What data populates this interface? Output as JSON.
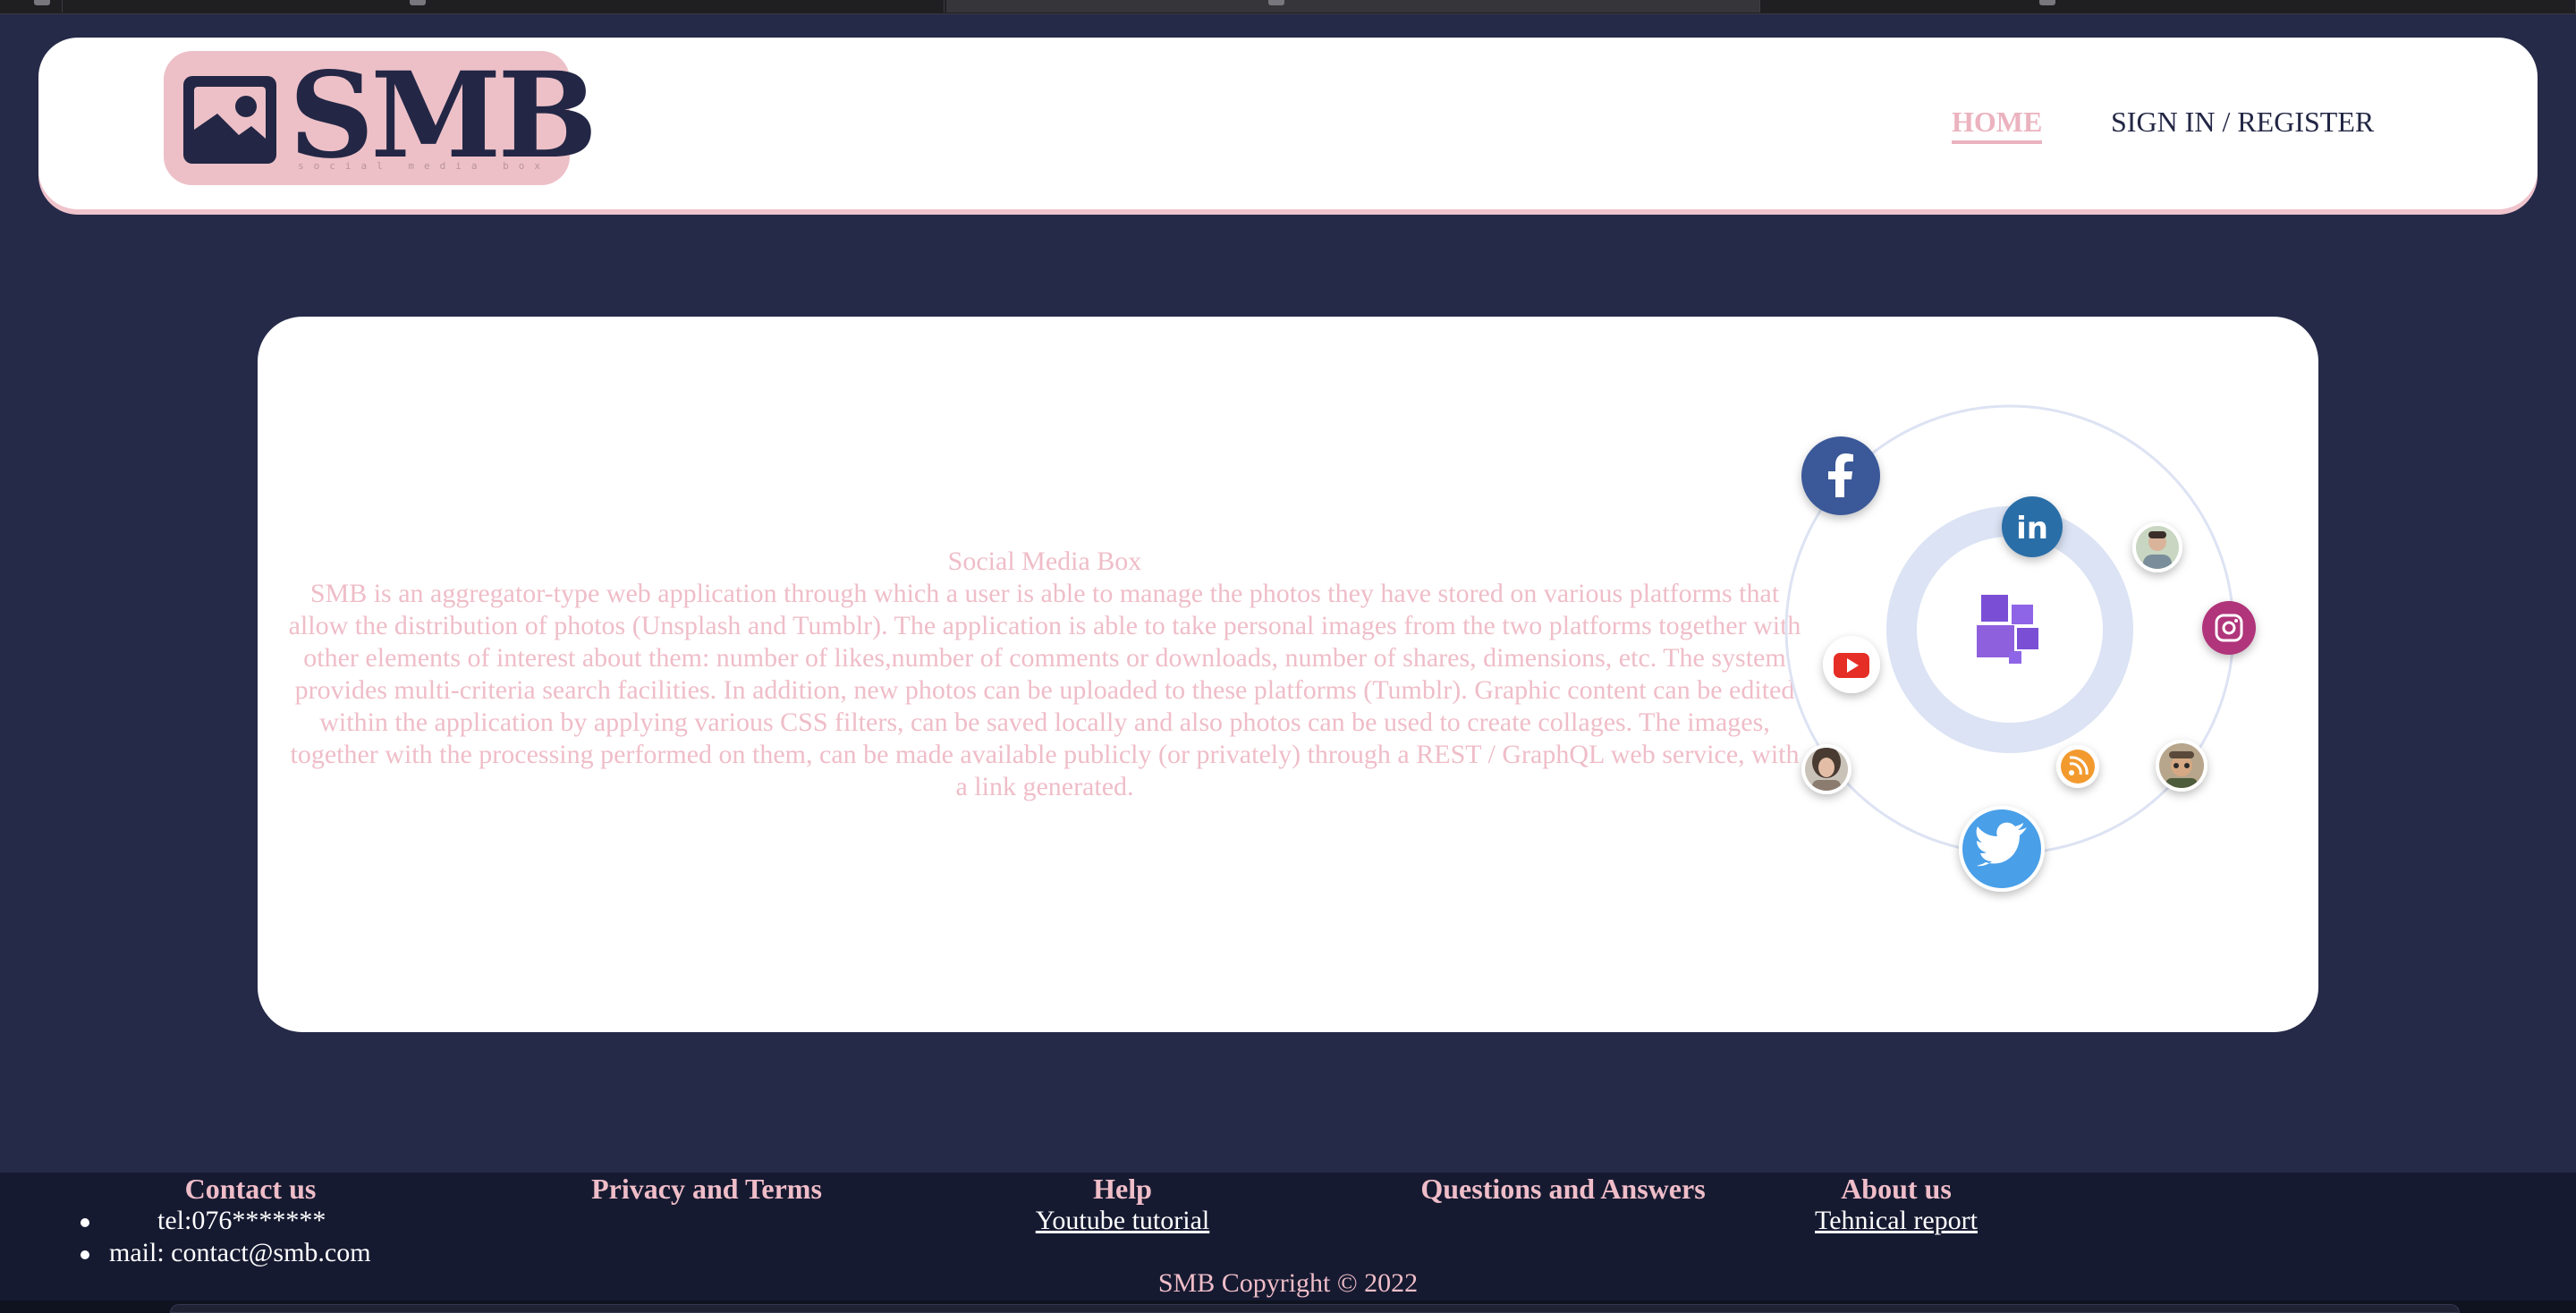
{
  "header": {
    "logo": {
      "wordmark": "SMB",
      "tagline": "social media box"
    },
    "nav": {
      "home": "HOME",
      "signin": "SIGN IN / REGISTER"
    }
  },
  "intro": {
    "title": "Social Media Box",
    "description": "SMB is an aggregator-type web application through which a user is able to manage the photos they have stored on various platforms that allow the distribution of photos (Unsplash and Tumblr). The application is able to take personal images from the two platforms together with other elements of interest about them: number of likes,number of comments or downloads, number of shares, dimensions, etc. The system provides multi-criteria search facilities. In addition, new photos can be uploaded to these platforms (Tumblr). Graphic content can be edited within the application by applying various CSS filters, can be saved locally and also photos can be used to create collages. The images, together with the processing performed on them, can be made available publicly (or privately) through a REST / GraphQL web service, with a link generated."
  },
  "diagram": {
    "icons": [
      "facebook-icon",
      "linkedin-icon",
      "instagram-icon",
      "youtube-icon",
      "rss-icon",
      "twitter-icon",
      "avatar-1",
      "avatar-2",
      "avatar-3",
      "avatar-4",
      "center-logo"
    ],
    "colors": {
      "facebook": "#3b5998",
      "linkedin": "#2a6ea7",
      "instagram": "#b0347a",
      "youtube": "#e52d27",
      "rss": "#f29a2e",
      "twitter": "#4a9fe8",
      "center": "#7a4fd6"
    }
  },
  "footer": {
    "contact": {
      "title": "Contact us",
      "phone": "tel:076*******",
      "mail": "mail: contact@smb.com"
    },
    "privacy": {
      "title": "Privacy and Terms"
    },
    "help": {
      "title": "Help",
      "link": "Youtube tutorial"
    },
    "qa": {
      "title": "Questions and Answers"
    },
    "about": {
      "title": "About us",
      "link": "Tehnical report"
    },
    "copyright": "SMB Copyright © 2022"
  },
  "colors": {
    "background": "#262a49",
    "accent_pink": "#efbdc8",
    "navy": "#232745",
    "footer": "#161a31"
  }
}
